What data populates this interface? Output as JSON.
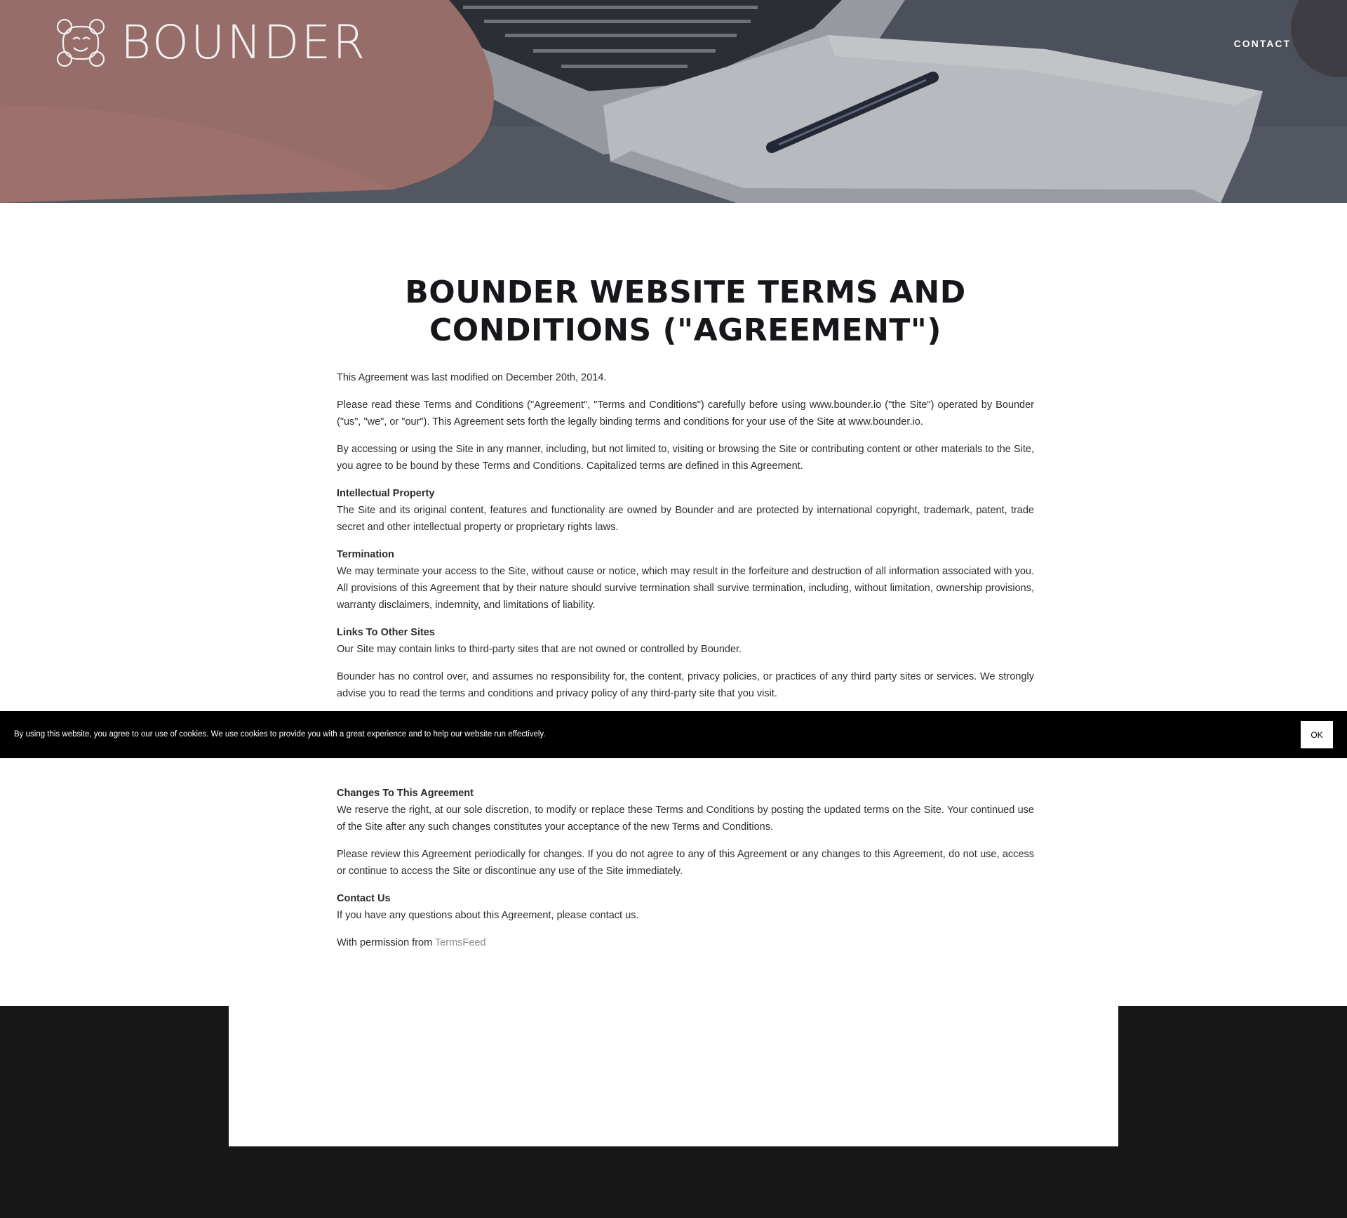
{
  "header": {
    "brand": "BOUNDER",
    "nav": {
      "contact_label": "CONTACT"
    }
  },
  "main": {
    "title": "BOUNDER WEBSITE TERMS AND CONDITIONS (\"AGREEMENT\")",
    "last_modified": "This Agreement was last modified on December 20th, 2014.",
    "intro_1": "Please read these Terms and Conditions (\"Agreement\", \"Terms and Conditions\") carefully before using www.bounder.io (\"the Site\") operated by Bounder (\"us\", \"we\", or \"our\"). This Agreement sets forth the legally binding terms and conditions for your use of the Site at www.bounder.io.",
    "intro_2": "By accessing or using the Site in any manner, including, but not limited to, visiting or browsing the Site or contributing content or other materials to the Site, you agree to be bound by these Terms and Conditions. Capitalized terms are defined in this Agreement.",
    "sections": {
      "ip": {
        "heading": "Intellectual Property",
        "body": "The Site and its original content, features and functionality are owned by Bounder and are protected by international copyright, trademark, patent, trade secret and other intellectual property or proprietary rights laws."
      },
      "termination": {
        "heading": "Termination",
        "body": "We may terminate your access to the Site, without cause or notice, which may result in the forfeiture and destruction of all information associated with you. All provisions of this Agreement that by their nature should survive termination shall survive termination, including, without limitation, ownership provisions, warranty disclaimers, indemnity, and limitations of liability."
      },
      "links": {
        "heading": "Links To Other Sites",
        "body": "Our Site may contain links to third-party sites that are not owned or controlled by Bounder.",
        "body_2": "Bounder has no control over, and assumes no responsibility for, the content, privacy policies, or practices of any third party sites or services. We strongly advise you to read the terms and conditions and privacy policy of any third-party site that you visit."
      },
      "changes": {
        "heading": "Changes To This Agreement",
        "body": "We reserve the right, at our sole discretion, to modify or replace these Terms and Conditions by posting the updated terms on the Site. Your continued use of the Site after any such changes constitutes your acceptance of the new Terms and Conditions.",
        "body_2": "Please review this Agreement periodically for changes. If you do not agree to any of this Agreement or any changes to this Agreement, do not use, access or continue to access the Site or discontinue any use of the Site immediately."
      },
      "contact": {
        "heading": "Contact Us",
        "body": "If you have any questions about this Agreement, please contact us."
      }
    },
    "permission": {
      "prefix": "With permission from ",
      "link_label": "TermsFeed"
    }
  },
  "cookie_banner": {
    "text": "By using this website, you agree to our use of cookies. We use cookies to provide you with a great experience and to help our website run effectively.",
    "ok_label": "OK"
  },
  "colors": {
    "footer_bg": "#171717",
    "cookie_bg": "#000000",
    "link_muted": "#8d8d8d",
    "title": "#16171b"
  },
  "icons": {
    "logo": "bounder-logo-icon"
  }
}
